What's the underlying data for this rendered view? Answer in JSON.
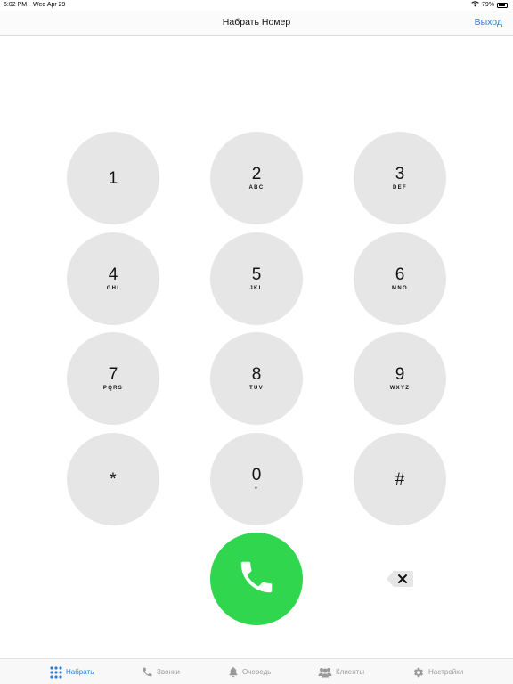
{
  "status_bar": {
    "time": "6:02 PM",
    "date": "Wed Apr 29",
    "battery": "79%",
    "battery_level": 0.79
  },
  "nav": {
    "title": "Набрать Номер",
    "exit_label": "Выход"
  },
  "keypad": [
    {
      "digit": "1",
      "letters": ""
    },
    {
      "digit": "2",
      "letters": "ABC"
    },
    {
      "digit": "3",
      "letters": "DEF"
    },
    {
      "digit": "4",
      "letters": "GHI"
    },
    {
      "digit": "5",
      "letters": "JKL"
    },
    {
      "digit": "6",
      "letters": "MNO"
    },
    {
      "digit": "7",
      "letters": "PQRS"
    },
    {
      "digit": "8",
      "letters": "TUV"
    },
    {
      "digit": "9",
      "letters": "WXYZ"
    },
    {
      "digit": "*",
      "letters": ""
    },
    {
      "digit": "0",
      "letters": "+"
    },
    {
      "digit": "#",
      "letters": ""
    }
  ],
  "icons": {
    "call": "phone-icon",
    "backspace": "backspace-icon"
  },
  "tabs": [
    {
      "label": "Набрать",
      "icon": "keypad-icon",
      "active": true
    },
    {
      "label": "Звонки",
      "icon": "phone-icon",
      "active": false
    },
    {
      "label": "Очередь",
      "icon": "bell-icon",
      "active": false
    },
    {
      "label": "Клиенты",
      "icon": "people-icon",
      "active": false
    },
    {
      "label": "Настройки",
      "icon": "gear-icon",
      "active": false
    }
  ],
  "colors": {
    "accent": "#2a7fd6",
    "call_green": "#2fd64e",
    "key_gray": "#e6e6e6",
    "tab_inactive": "#9a9a9a"
  }
}
